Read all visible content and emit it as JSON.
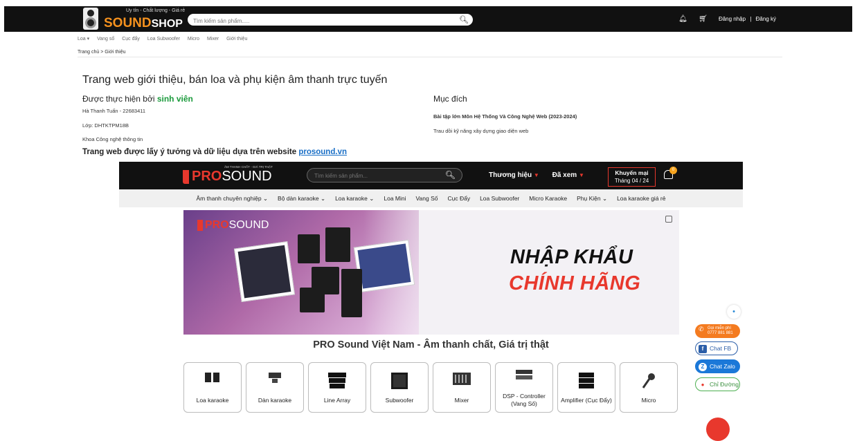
{
  "header": {
    "tagline": "Uy tín - Chất lượng - Giá rẻ",
    "brand_a": "SOUND",
    "brand_b": "SHOP",
    "search_placeholder": "Tìm kiếm sản phẩm.....",
    "login": "Đăng nhập",
    "separator": "|",
    "register": "Đăng ký",
    "icons": [
      "bell-icon",
      "cart-icon",
      "search-icon"
    ]
  },
  "nav": [
    "Loa ▾",
    "Vang số",
    "Cục đẩy",
    "Loa Subwoofer",
    "Micro",
    "Mixer",
    "Giới thiệu"
  ],
  "breadcrumb": "Trang chủ > Giới thiệu",
  "main": {
    "title": "Trang web giới thiệu, bán loa và phụ kiện âm thanh trực tuyến",
    "by_prefix": "Được thực hiện bởi ",
    "by_highlight": "sinh viên",
    "student": "Hà Thanh Tuấn - 22683411",
    "class": "Lớp: DHTKTPM18B",
    "faculty": "Khoa Công nghệ thông tin",
    "purpose_title": "Mục đích",
    "purpose_course": "Bài tập lớn Môn Hệ Thống Và Công Nghệ Web (2023-2024)",
    "purpose_desc": "Trau dồi kỹ năng xây dựng giao diện web",
    "source_prefix": "Trang web được lấy ý tưởng và dữ liệu dựa trên website ",
    "source_link": "prosound.vn"
  },
  "embed": {
    "logo_sub": "ÂM THANH CHẤT - GIÁ TRỊ THẬT",
    "logo_pro": "PRO",
    "logo_sound": "SOUND",
    "search_placeholder": "Tìm kiếm sản phẩm...",
    "brand_menu": "Thương hiệu",
    "viewed_menu": "Đã xem",
    "promo_line1": "Khuyến mại",
    "promo_line2": "Tháng 04 / 24",
    "cart_count": "0",
    "nav": [
      "Âm thanh chuyên nghiệp ⌄",
      "Bộ dàn karaoke ⌄",
      "Loa karaoke ⌄",
      "Loa Mini",
      "Vang Số",
      "Cục Đẩy",
      "Loa Subwoofer",
      "Micro Karaoke",
      "Phụ Kiện ⌄",
      "Loa karaoke giá rẻ"
    ],
    "banner_line1": "NHẬP KHẨU",
    "banner_line2": "CHÍNH HÃNG",
    "section_title": "PRO Sound Việt Nam - Âm thanh chất, Giá trị thật",
    "categories": [
      {
        "label": "Loa karaoke"
      },
      {
        "label": "Dàn karaoke"
      },
      {
        "label": "Line Array"
      },
      {
        "label": "Subwoofer"
      },
      {
        "label": "Mixer"
      },
      {
        "label": "DSP - Controller (Vang Số)"
      },
      {
        "label": "Amplifier (Cục Đẩy)"
      },
      {
        "label": "Micro"
      }
    ]
  },
  "side_buttons": {
    "call_line1": "Gọi miễn phí",
    "call_line2": "0777 881 881",
    "fb": "Chat FB",
    "zalo": "Chat Zalo",
    "map": "Chỉ Đường"
  }
}
